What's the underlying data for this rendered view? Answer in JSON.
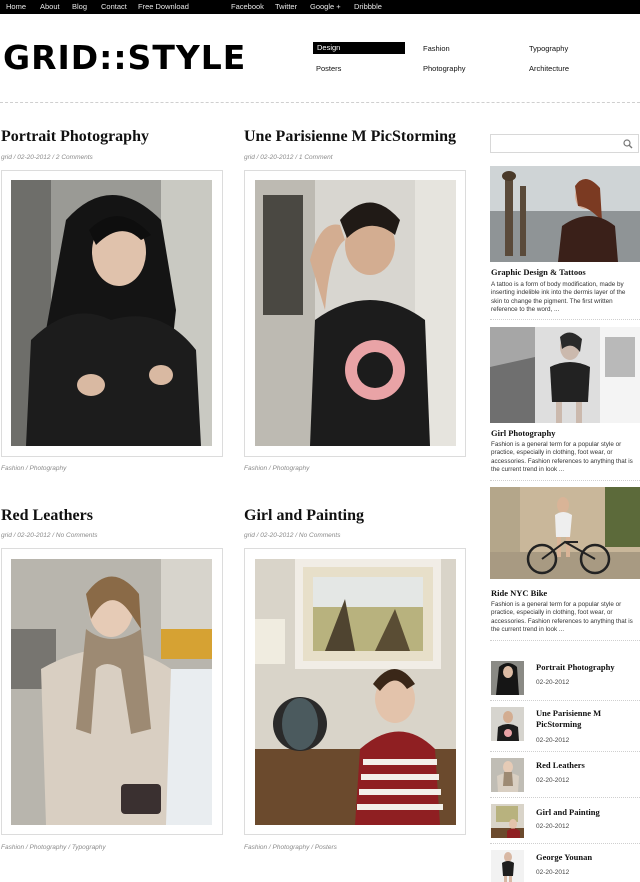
{
  "topnav": {
    "left": [
      "Home",
      "About",
      "Blog",
      "Contact",
      "Free Download"
    ],
    "right": [
      "Facebook",
      "Twitter",
      "Google +",
      "Dribbble"
    ]
  },
  "logo": "GRID::STYLE",
  "categories": [
    "Design",
    "Fashion",
    "Typography",
    "Posters",
    "Photography",
    "Architecture"
  ],
  "active_category": "Design",
  "posts": [
    {
      "title": "Portrait Photography",
      "meta": "grid / 02-20-2012 / 2 Comments",
      "cats": "Fashion / Photography"
    },
    {
      "title": "Une Parisienne M PicStorming",
      "meta": "grid / 02-20-2012 / 1 Comment",
      "cats": "Fashion / Photography"
    },
    {
      "title": "Red Leathers",
      "meta": "grid / 02-20-2012 / No Comments",
      "cats": "Fashion / Photography / Typography"
    },
    {
      "title": "Girl and Painting",
      "meta": "grid / 02-20-2012 / No Comments",
      "cats": "Fashion / Photography / Posters"
    }
  ],
  "search": {
    "placeholder": ""
  },
  "featured": [
    {
      "title": "Graphic Design & Tattoos",
      "text": "A tattoo is a form of body modification, made by inserting indelible ink into the dermis layer of the skin to change the pigment. The first written reference to the word, ..."
    },
    {
      "title": "Girl Photography",
      "text": "Fashion is a general term for a popular style or practice, especially in clothing, foot wear, or accessories. Fashion references to anything that is the current trend in look ..."
    },
    {
      "title": "Ride NYC Bike",
      "text": "Fashion is a general term for a popular style or practice, especially in clothing, foot wear, or accessories. Fashion references to anything that is the current trend in look ..."
    }
  ],
  "recent": [
    {
      "title": "Portrait Photography",
      "date": "02-20-2012"
    },
    {
      "title": "Une Parisienne M PicStorming",
      "date": "02-20-2012"
    },
    {
      "title": "Red Leathers",
      "date": "02-20-2012"
    },
    {
      "title": "Girl and Painting",
      "date": "02-20-2012"
    },
    {
      "title": "George Younan",
      "date": "02-20-2012"
    }
  ]
}
